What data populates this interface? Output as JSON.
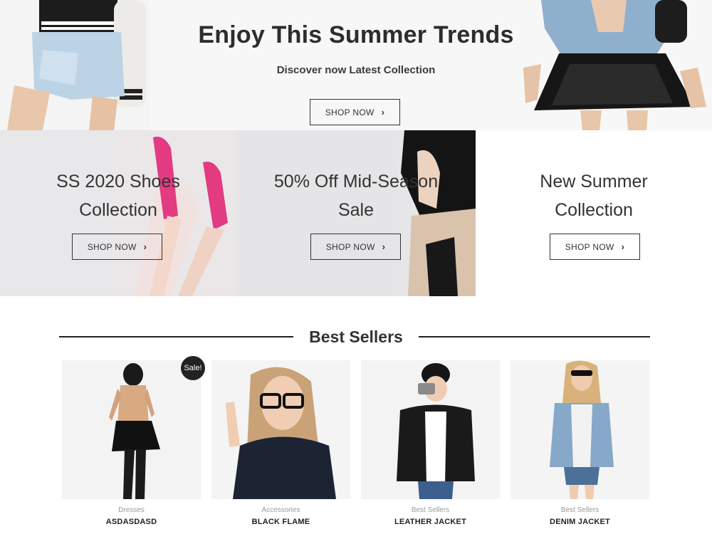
{
  "hero": {
    "title": "Enjoy This Summer Trends",
    "subtitle": "Discover now Latest Collection",
    "button_label": "SHOP NOW"
  },
  "banners": [
    {
      "title_line1": "SS 2020 Shoes",
      "title_line2": "Collection",
      "button_label": "SHOP NOW"
    },
    {
      "title_line1": "50% Off Mid-Season",
      "title_line2": "Sale",
      "button_label": "SHOP NOW"
    },
    {
      "title_line1": "New Summer",
      "title_line2": "Collection",
      "button_label": "SHOP NOW"
    }
  ],
  "best_sellers": {
    "title": "Best Sellers",
    "sale_badge": "Sale!",
    "products": [
      {
        "category": "Dresses",
        "name": "ASDASDASD",
        "price": ""
      },
      {
        "category": "Accessories",
        "name": "BLACK FLAME",
        "price": ""
      },
      {
        "category": "Best Sellers",
        "name": "LEATHER JACKET",
        "price": ""
      },
      {
        "category": "Best Sellers",
        "name": "DENIM JACKET",
        "price": ""
      }
    ]
  },
  "icons": {
    "chevron": "chevron-right-icon"
  },
  "colors": {
    "text_dark": "#333333",
    "badge": "#222222",
    "hero_bg": "#f7f7f7",
    "banner_bg": "#e8e8ea"
  }
}
